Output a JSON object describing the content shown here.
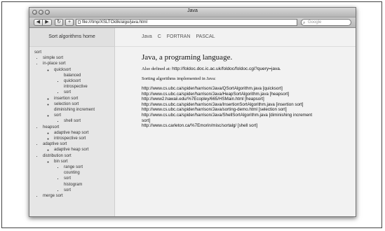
{
  "window": {
    "title": "Java"
  },
  "toolbar": {
    "back_icon": "◀",
    "forward_icon": "▶",
    "reload_icon": "↻",
    "add_icon": "+",
    "url": "file:///tmp/XSLTCk8k/algo/java.html",
    "search_placeholder": "Google"
  },
  "sidebar": {
    "header": "Sort algorithms home",
    "root": "sort",
    "items": {
      "simple": "simple sort",
      "inplace": "in-place sort",
      "quicksort": "quicksort",
      "balanced": "balanced quicksort",
      "introspective": "introspective sort",
      "insertion": "insertion sort",
      "selection": "selection sort",
      "diminishing": "diminishing increment sort",
      "shell": "shell sort",
      "heapsort": "heapsort",
      "adaptive_heap": "adaptive heap sort",
      "introspective2": "introspective sort",
      "adaptive": "adaptive sort",
      "adaptive_heap2": "adaptive heap sort",
      "distribution": "distribution sort",
      "bin": "bin sort",
      "range": "range sort",
      "counting": "counting sort",
      "histogram": "histogram sort",
      "merge": "merge sort"
    }
  },
  "nav": [
    "Java",
    "C",
    "FORTRAN",
    "PASCAL"
  ],
  "main": {
    "heading": "Java, a programing language.",
    "also_label": "Also defined at:",
    "also_link": "http://foldoc.doc.ic.ac.uk/foldoc/foldoc.cgi?query=java",
    "also_end": ".",
    "impl_label": "Sorting algorithms implemented in Java:",
    "links": [
      "http://www.cs.ubc.ca/spider/harrison/Java/QSortAlgorithm.java [quicksort]",
      "http://www.cs.ubc.ca/spider/harrison/Java/HeapSortAlgorithm.java [heapsort]",
      "http://www2.hawaii.edu/%7Ecopley/665/HSMain.html [heapsort]",
      "http://www.cs.ubc.ca/spider/harrison/Java/InsertionSortAlgorithm.java [insertion sort]",
      "http://www.cs.ubc.ca/spider/harrison/Java/sorting-demo.html [selection sort]",
      "http://www.cs.ubc.ca/spider/harrison/Java/ShellSortAlgorithm.java [diminishing increment",
      "sort]",
      "http://www.cs.carleton.ca/%7Emorin/misc/sortalg/ [shell sort]"
    ]
  }
}
